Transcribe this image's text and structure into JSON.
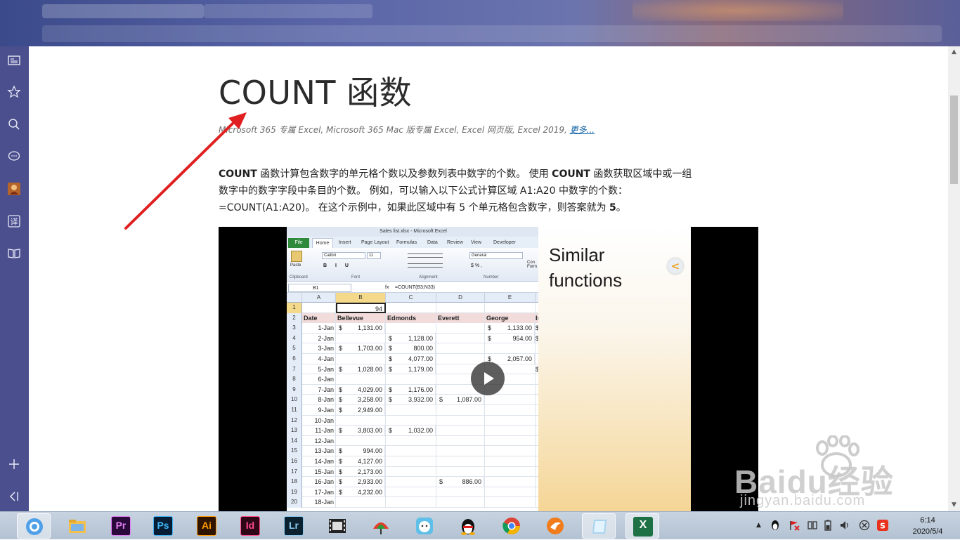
{
  "article": {
    "title": "COUNT 函数",
    "applies_to": "Microsoft 365 专属 Excel, Microsoft 365 Mac 版专属 Excel, Excel 网页版, Excel 2019, ",
    "more_link": "更多...",
    "para_line1_bold1": "COUNT",
    "para_line1_text1": " 函数计算包含数字的单元格个数以及参数列表中数字的个数。 使用 ",
    "para_line1_bold2": "COUNT",
    "para_line1_text2": " 函数获取区域中或一组",
    "para_line2": "数字中的数字字段中条目的个数。 例如，可以输入以下公式计算区域 A1:A20 中数字的个数：",
    "para_line3_text": "=COUNT(A1:A20)。 在这个示例中，如果此区域中有 5 个单元格包含数字，则答案就为 ",
    "para_line3_bold": "5",
    "para_line3_end": "。"
  },
  "video": {
    "excel_title": "Sales list.xlsx - Microsoft Excel",
    "tabs": [
      "File",
      "Home",
      "Insert",
      "Page Layout",
      "Formulas",
      "Data",
      "Review",
      "View",
      "Developer"
    ],
    "ribbon": {
      "paste": "Paste",
      "clipboard": "Clipboard",
      "font_name": "Calibri",
      "font_size": "11",
      "font_group": "Font",
      "alignment_group": "Alignment",
      "number_format": "General",
      "number_group": "Number",
      "cond_format": "Con Form"
    },
    "name_box": "B1",
    "fx": "fx",
    "formula": "=COUNT(B3:N33)",
    "columns": [
      "A",
      "B",
      "C",
      "D",
      "E"
    ],
    "b1_value": "94",
    "headers": [
      "Date",
      "Bellevue",
      "Edmonds",
      "Everett",
      "George",
      "Is"
    ],
    "rows": [
      {
        "n": "3",
        "a": "1-Jan",
        "b": "1,131.00",
        "c": "",
        "d": "",
        "e": "1,133.00",
        "f": "$"
      },
      {
        "n": "4",
        "a": "2-Jan",
        "b": "",
        "c": "1,128.00",
        "d": "",
        "e": "954.00",
        "f": "$"
      },
      {
        "n": "5",
        "a": "3-Jan",
        "b": "1,703.00",
        "c": "800.00",
        "d": "",
        "e": "",
        "f": ""
      },
      {
        "n": "6",
        "a": "4-Jan",
        "b": "",
        "c": "4,077.00",
        "d": "",
        "e": "2,057.00",
        "f": ""
      },
      {
        "n": "7",
        "a": "5-Jan",
        "b": "1,028.00",
        "c": "1,179.00",
        "d": "",
        "e": "",
        "f": "$"
      },
      {
        "n": "8",
        "a": "6-Jan",
        "b": "",
        "c": "",
        "d": "",
        "e": "",
        "f": ""
      },
      {
        "n": "9",
        "a": "7-Jan",
        "b": "4,029.00",
        "c": "1,176.00",
        "d": "",
        "e": "",
        "f": ""
      },
      {
        "n": "10",
        "a": "8-Jan",
        "b": "3,258.00",
        "c": "3,932.00",
        "d": "1,087.00",
        "e": "",
        "f": ""
      },
      {
        "n": "11",
        "a": "9-Jan",
        "b": "2,949.00",
        "c": "",
        "d": "",
        "e": "",
        "f": ""
      },
      {
        "n": "12",
        "a": "10-Jan",
        "b": "",
        "c": "",
        "d": "",
        "e": "",
        "f": ""
      },
      {
        "n": "13",
        "a": "11-Jan",
        "b": "3,803.00",
        "c": "1,032.00",
        "d": "",
        "e": "",
        "f": ""
      },
      {
        "n": "14",
        "a": "12-Jan",
        "b": "",
        "c": "",
        "d": "",
        "e": "",
        "f": ""
      },
      {
        "n": "15",
        "a": "13-Jan",
        "b": "994.00",
        "c": "",
        "d": "",
        "e": "",
        "f": ""
      },
      {
        "n": "16",
        "a": "14-Jan",
        "b": "4,127.00",
        "c": "",
        "d": "",
        "e": "",
        "f": ""
      },
      {
        "n": "17",
        "a": "15-Jan",
        "b": "2,173.00",
        "c": "",
        "d": "",
        "e": "",
        "f": ""
      },
      {
        "n": "18",
        "a": "16-Jan",
        "b": "2,933.00",
        "c": "",
        "d": "886.00",
        "e": "",
        "f": ""
      },
      {
        "n": "19",
        "a": "17-Jan",
        "b": "4,232.00",
        "c": "",
        "d": "",
        "e": "",
        "f": ""
      },
      {
        "n": "20",
        "a": "18-Jan",
        "b": "",
        "c": "",
        "d": "",
        "e": "",
        "f": ""
      }
    ],
    "currency": "$",
    "side_panel_title_1": "Similar",
    "side_panel_title_2": "functions"
  },
  "watermark": {
    "brand": "Baidu经验",
    "url": "jingyan.baidu.com"
  },
  "taskbar": {
    "apps": [
      "Pr",
      "Ps",
      "Ai",
      "Id",
      "Lr",
      "X"
    ],
    "time": "6:14",
    "date": "2020/5/4"
  },
  "colors": {
    "sidebar": "#4b4f8d",
    "arrow": "#e02020",
    "link": "#0b5fa5",
    "excel_green": "#1e7145"
  }
}
